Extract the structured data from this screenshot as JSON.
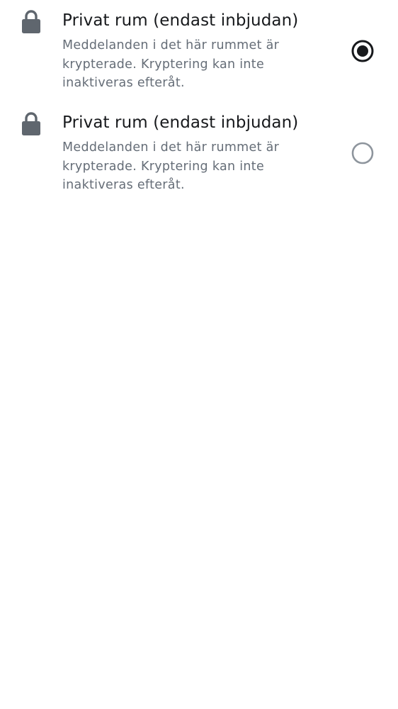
{
  "options": [
    {
      "icon": "lock-icon",
      "title": "Privat rum (endast inbjudan)",
      "description": "Meddelanden i det här rummet är krypterade. Kryptering kan inte inaktiveras efteråt.",
      "selected": true
    },
    {
      "icon": "lock-icon",
      "title": "Privat rum (endast inbjudan)",
      "description": "Meddelanden i det här rummet är krypterade. Kryptering kan inte inaktiveras efteråt.",
      "selected": false
    }
  ],
  "colors": {
    "icon": "#5f666e",
    "title": "#17191c",
    "description": "#656d77",
    "radio_selected": "#17191c",
    "radio_unselected": "#8e959d",
    "background": "#ffffff"
  }
}
